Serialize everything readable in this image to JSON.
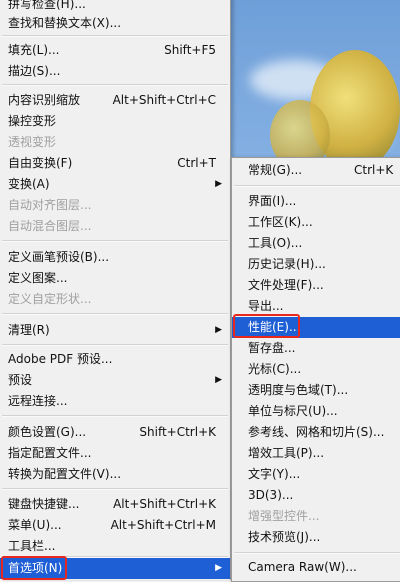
{
  "edit_menu": {
    "items": [
      {
        "label": "拼写检查(H)...",
        "shortcut": "",
        "disabled": false
      },
      {
        "label": "查找和替换文本(X)...",
        "shortcut": "",
        "disabled": false
      },
      {
        "label": "填充(L)...",
        "shortcut": "Shift+F5",
        "disabled": false
      },
      {
        "label": "描边(S)...",
        "shortcut": "",
        "disabled": false
      },
      {
        "label": "内容识别缩放",
        "shortcut": "Alt+Shift+Ctrl+C",
        "disabled": false
      },
      {
        "label": "操控变形",
        "shortcut": "",
        "disabled": false
      },
      {
        "label": "透视变形",
        "shortcut": "",
        "disabled": true
      },
      {
        "label": "自由变换(F)",
        "shortcut": "Ctrl+T",
        "disabled": false
      },
      {
        "label": "变换(A)",
        "shortcut": "",
        "disabled": false
      },
      {
        "label": "自动对齐图层...",
        "shortcut": "",
        "disabled": true
      },
      {
        "label": "自动混合图层...",
        "shortcut": "",
        "disabled": true
      },
      {
        "label": "定义画笔预设(B)...",
        "shortcut": "",
        "disabled": false
      },
      {
        "label": "定义图案...",
        "shortcut": "",
        "disabled": false
      },
      {
        "label": "定义自定形状...",
        "shortcut": "",
        "disabled": true
      },
      {
        "label": "清理(R)",
        "shortcut": "",
        "disabled": false
      },
      {
        "label": "Adobe PDF 预设...",
        "shortcut": "",
        "disabled": false
      },
      {
        "label": "预设",
        "shortcut": "",
        "disabled": false
      },
      {
        "label": "远程连接...",
        "shortcut": "",
        "disabled": false
      },
      {
        "label": "颜色设置(G)...",
        "shortcut": "Shift+Ctrl+K",
        "disabled": false
      },
      {
        "label": "指定配置文件...",
        "shortcut": "",
        "disabled": false
      },
      {
        "label": "转换为配置文件(V)...",
        "shortcut": "",
        "disabled": false
      },
      {
        "label": "键盘快捷键...",
        "shortcut": "Alt+Shift+Ctrl+K",
        "disabled": false
      },
      {
        "label": "菜单(U)...",
        "shortcut": "Alt+Shift+Ctrl+M",
        "disabled": false
      },
      {
        "label": "工具栏...",
        "shortcut": "",
        "disabled": false
      },
      {
        "label": "首选项(N)",
        "shortcut": "",
        "disabled": false
      }
    ],
    "submenu_arrow": "▶"
  },
  "preferences_submenu": {
    "items": [
      {
        "label": "常规(G)...",
        "shortcut": "Ctrl+K",
        "disabled": false
      },
      {
        "label": "界面(I)...",
        "shortcut": "",
        "disabled": false
      },
      {
        "label": "工作区(K)...",
        "shortcut": "",
        "disabled": false
      },
      {
        "label": "工具(O)...",
        "shortcut": "",
        "disabled": false
      },
      {
        "label": "历史记录(H)...",
        "shortcut": "",
        "disabled": false
      },
      {
        "label": "文件处理(F)...",
        "shortcut": "",
        "disabled": false
      },
      {
        "label": "导出...",
        "shortcut": "",
        "disabled": false
      },
      {
        "label": "性能(E)...",
        "shortcut": "",
        "disabled": false
      },
      {
        "label": "暂存盘...",
        "shortcut": "",
        "disabled": false
      },
      {
        "label": "光标(C)...",
        "shortcut": "",
        "disabled": false
      },
      {
        "label": "透明度与色域(T)...",
        "shortcut": "",
        "disabled": false
      },
      {
        "label": "单位与标尺(U)...",
        "shortcut": "",
        "disabled": false
      },
      {
        "label": "参考线、网格和切片(S)...",
        "shortcut": "",
        "disabled": false
      },
      {
        "label": "增效工具(P)...",
        "shortcut": "",
        "disabled": false
      },
      {
        "label": "文字(Y)...",
        "shortcut": "",
        "disabled": false
      },
      {
        "label": "3D(3)...",
        "shortcut": "",
        "disabled": false
      },
      {
        "label": "增强型控件...",
        "shortcut": "",
        "disabled": true
      },
      {
        "label": "技术预览(J)...",
        "shortcut": "",
        "disabled": false
      },
      {
        "label": "Camera Raw(W)...",
        "shortcut": "",
        "disabled": false
      }
    ]
  },
  "colors": {
    "highlight": "#1f5fd6",
    "annotation_box": "#e8271e",
    "menu_bg": "#f0f0f0"
  }
}
